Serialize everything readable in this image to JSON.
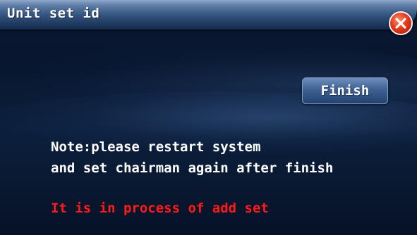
{
  "window": {
    "title": "Unit set id",
    "close_icon": "close-icon"
  },
  "actions": {
    "finish_label": "Finish"
  },
  "note": {
    "line1": "Note:please restart system",
    "line2": "and set chairman again after finish"
  },
  "status": {
    "text": "It is in process of add set",
    "color": "#ff1a1a"
  },
  "colors": {
    "background": "#0a1a33",
    "titlebar": "#34557f",
    "close": "#e53a1c"
  }
}
